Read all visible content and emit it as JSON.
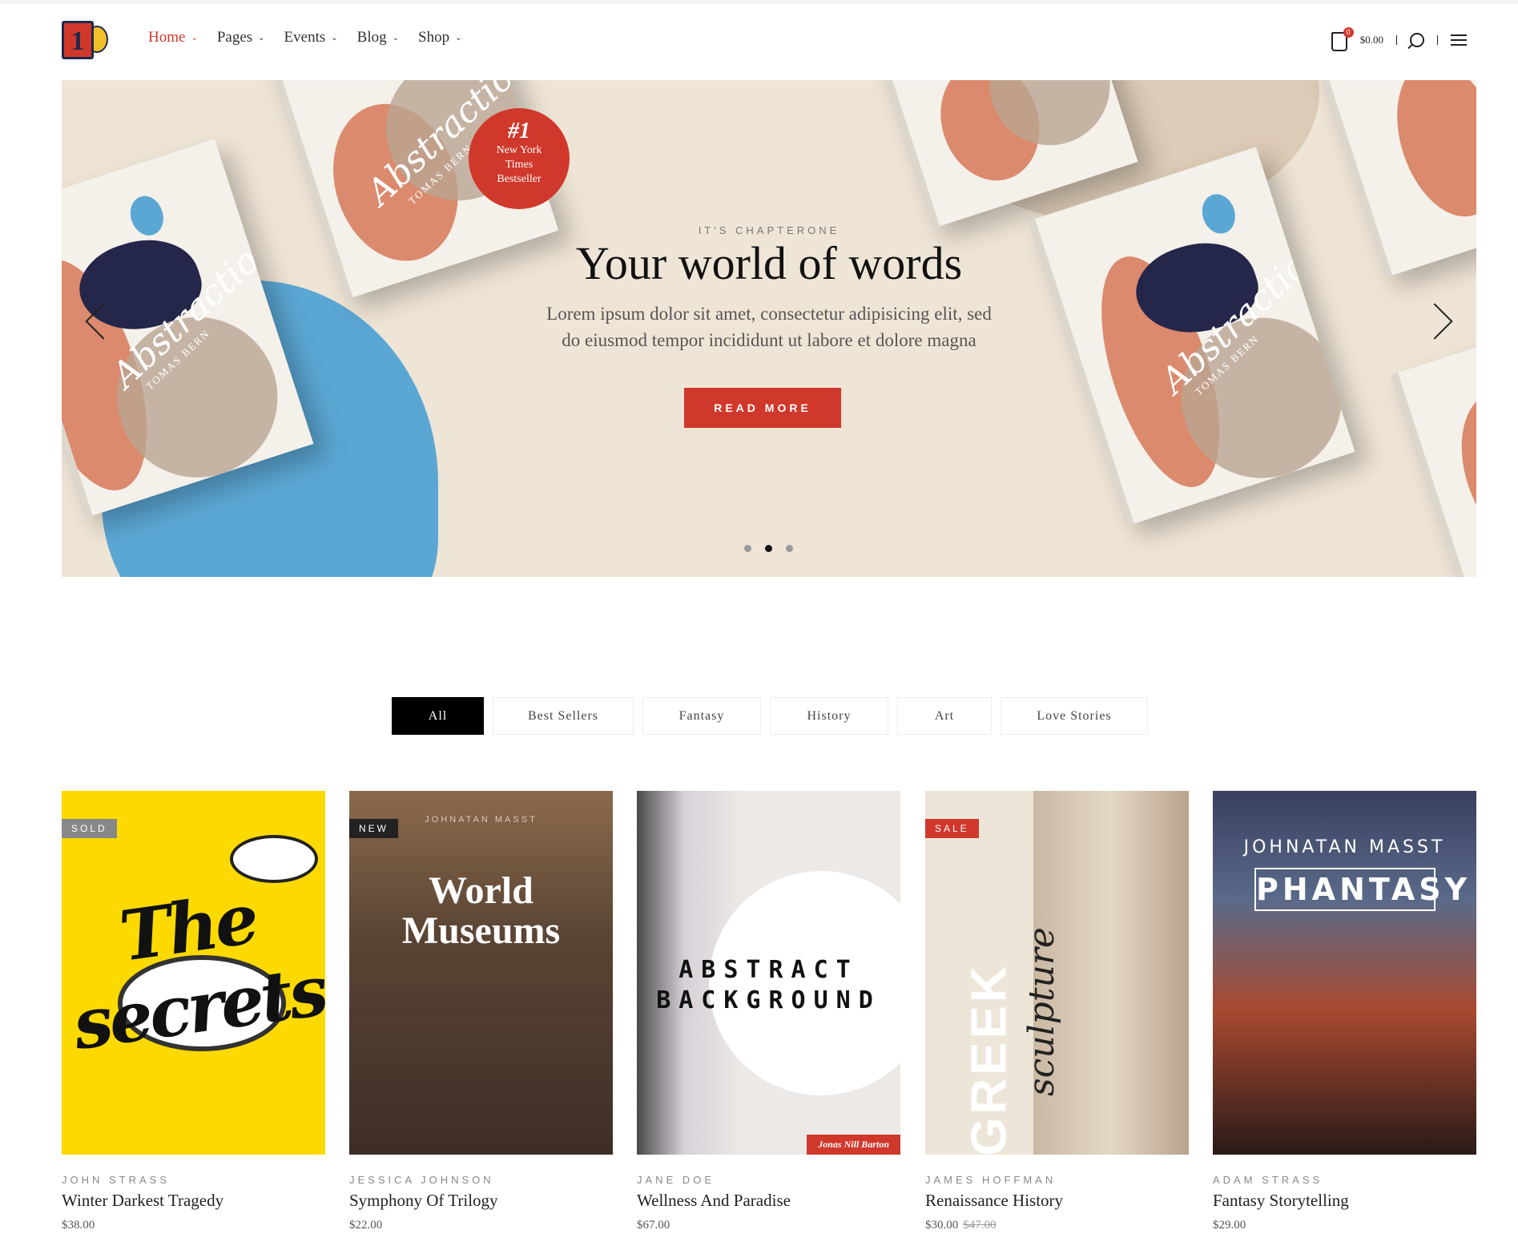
{
  "header": {
    "logo_text": "1",
    "nav": [
      {
        "label": "Home",
        "active": true
      },
      {
        "label": "Pages"
      },
      {
        "label": "Events"
      },
      {
        "label": "Blog"
      },
      {
        "label": "Shop"
      }
    ],
    "cart_count": "0",
    "cart_total": "$0.00",
    "icons": [
      "cart-icon",
      "search-icon",
      "menu-icon"
    ]
  },
  "hero": {
    "subtitle": "IT'S CHAPTERONE",
    "title": "Your world of words",
    "paragraph_line1": "Lorem ipsum dolor sit amet, consectetur adipisicing elit, sed",
    "paragraph_line2": "do eiusmod tempor incididunt ut labore et dolore magna",
    "button": "READ MORE",
    "seal_top": "#1",
    "seal_text": "New York Times Bestseller",
    "book_title": "Abstraction",
    "book_author": "TOMAS BERN",
    "active_slide": 2,
    "slides": 3,
    "accent": "#d0382b",
    "bg": "#efe5d6"
  },
  "filters": [
    "All",
    "Best Sellers",
    "Fantasy",
    "History",
    "Art",
    "Love Stories"
  ],
  "products": [
    {
      "author": "JOHN STRASS",
      "title": "Winter Darkest Tragedy",
      "price": "$38.00",
      "badge": "SOLD",
      "cover_text": "The secrets"
    },
    {
      "author": "JESSICA JOHNSON",
      "title": "Symphony Of Trilogy",
      "price": "$22.00",
      "badge": "NEW",
      "cover_text": "World Museums",
      "cover_sub": "JOHNATAN MASST"
    },
    {
      "author": "JANE DOE",
      "title": "Wellness And Paradise",
      "price": "$67.00",
      "cover_text": "ABSTRACT BACKGROUND",
      "cover_sub": "Jonas Nill Barton"
    },
    {
      "author": "JAMES HOFFMAN",
      "title": "Renaissance History",
      "price": "$30.00",
      "old_price": "$47.00",
      "badge": "SALE",
      "cover_text": "GREEK",
      "cover_sub": "sculpture"
    },
    {
      "author": "ADAM STRASS",
      "title": "Fantasy Storytelling",
      "price": "$29.00",
      "cover_text": "PHANTASY",
      "cover_sub": "JOHNATAN MASST"
    }
  ]
}
